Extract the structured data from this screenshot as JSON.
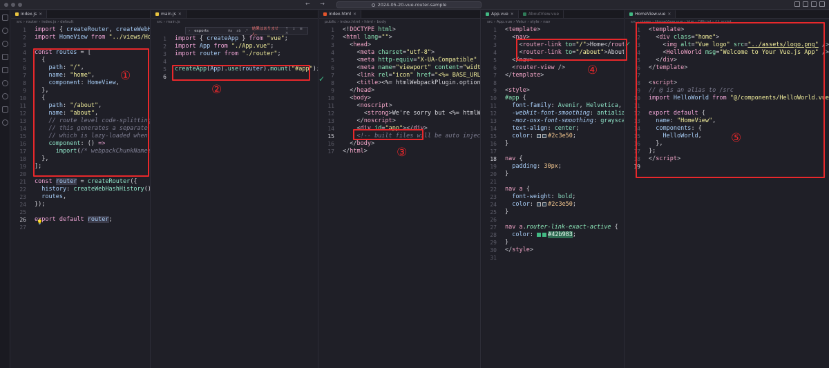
{
  "window": {
    "title": "2024-05-20-vue-router-sample",
    "nav_arrows": "← →"
  },
  "icons": {
    "activity": [
      "explorer-icon",
      "search-icon",
      "source-control-icon",
      "run-debug-icon",
      "extensions-icon",
      "remote-icon",
      "testing-icon",
      "accounts-icon"
    ]
  },
  "panes": {
    "p1": {
      "tab": "index.js",
      "crumbs": "src  ›  router  ›  index.js  ›  default",
      "lines": [
        "1",
        "2",
        "3",
        "4",
        "5",
        "6",
        "7",
        "8",
        "9",
        "10",
        "11",
        "12",
        "13",
        "14",
        "15",
        "16",
        "17",
        "18",
        "19",
        "20",
        "21",
        "22",
        "23",
        "24",
        "25",
        "26",
        "27"
      ],
      "current_line": "26"
    },
    "p2": {
      "tab": "main.js",
      "crumbs": "src  ›  main.js",
      "popup": {
        "label": "exports",
        "case": "Aa",
        "word": "ab",
        "regex": ".*",
        "result": "結果はありません。",
        "icons": "↑ ↓ ≡ ×"
      },
      "current_line": "6"
    },
    "p3": {
      "tab": "index.html",
      "crumbs": "public  ›  index.html  ›  html  ›  body",
      "current_line": "15"
    },
    "p4": {
      "tabs": [
        "App.vue",
        "AboutView.vue"
      ],
      "crumbs": "src  ›  App.vue  ›  Vetur  ›  style  ›  nav",
      "current_line": "18"
    },
    "p5": {
      "tab": "HomeView.vue",
      "crumbs": "src  ›  views  ›  HomeView.vue  ›  Vue - Official  ›  {} script",
      "current_line": "19"
    }
  },
  "annotations": {
    "n1": "①",
    "n2": "②",
    "n3": "③",
    "n4": "④",
    "n5": "⑤"
  },
  "colors": {
    "annotation": "#e8282b",
    "accent_green": "#42b983",
    "text_color": "#2c3e50"
  }
}
